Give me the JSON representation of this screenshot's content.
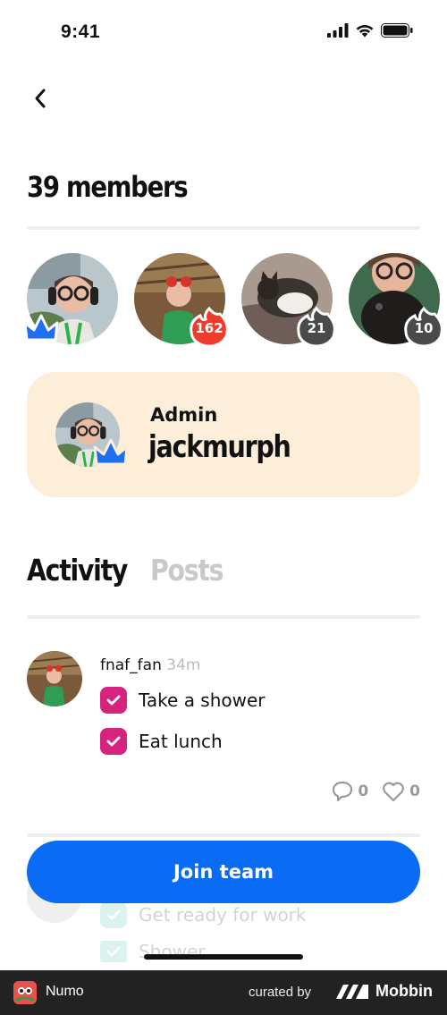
{
  "status_bar": {
    "time": "9:41"
  },
  "header": {
    "title": "39 members"
  },
  "members": [
    {
      "name": "jackmurph",
      "badge": "admin-crown",
      "badge_color": "#1f6ff2"
    },
    {
      "name": "fnaf_fan",
      "streak": "162",
      "badge_color": "#ef3b2c"
    },
    {
      "name": "cat-member",
      "streak": "21",
      "badge_color": "#4a4a4a"
    },
    {
      "name": "glasses-member",
      "streak": "10",
      "badge_color": "#4a4a4a"
    }
  ],
  "admin_card": {
    "role": "Admin",
    "username": "jackmurph",
    "background": "#fdeeda"
  },
  "tabs": [
    {
      "label": "Activity",
      "active": true
    },
    {
      "label": "Posts",
      "active": false
    }
  ],
  "posts": [
    {
      "user": "fnaf_fan",
      "time": "34m",
      "tasks": [
        "Take a shower",
        "Eat lunch"
      ],
      "comments": "0",
      "likes": "0"
    }
  ],
  "faded_post": {
    "tasks": [
      "Get ready for work",
      "Shower"
    ]
  },
  "join_button": {
    "label": "Join team",
    "color": "#0a6cf5"
  },
  "footer": {
    "app_name": "Numo",
    "curated_by": "curated by",
    "brand": "Mobbin"
  },
  "colors": {
    "checkbox": "#d6237e",
    "accent": "#0a6cf5"
  }
}
